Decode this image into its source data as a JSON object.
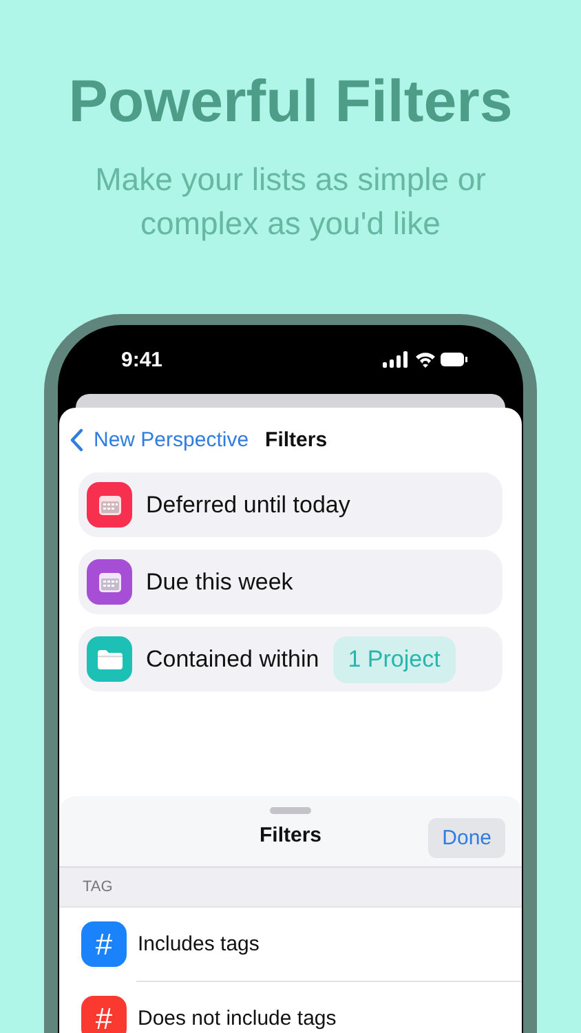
{
  "headline": "Powerful Filters",
  "subtitle": "Make your lists as simple or complex as you'd like",
  "status_bar": {
    "time": "9:41"
  },
  "nav": {
    "back": "New Perspective",
    "title": "Filters"
  },
  "filters": [
    {
      "kind": "calendar",
      "color": "#f8304f",
      "label": "Deferred until today"
    },
    {
      "kind": "calendar",
      "color": "#a64fd6",
      "label": "Due this week"
    },
    {
      "kind": "folder",
      "color": "#1cc0b4",
      "label": "Contained within",
      "chip": "1 Project"
    }
  ],
  "sheet": {
    "title": "Filters",
    "done": "Done",
    "section": "TAG",
    "items": [
      {
        "glyph": "#",
        "color": "#1a82fb",
        "label": "Includes tags"
      },
      {
        "glyph": "#",
        "color": "#fa3a30",
        "label": "Does not include tags"
      }
    ]
  }
}
